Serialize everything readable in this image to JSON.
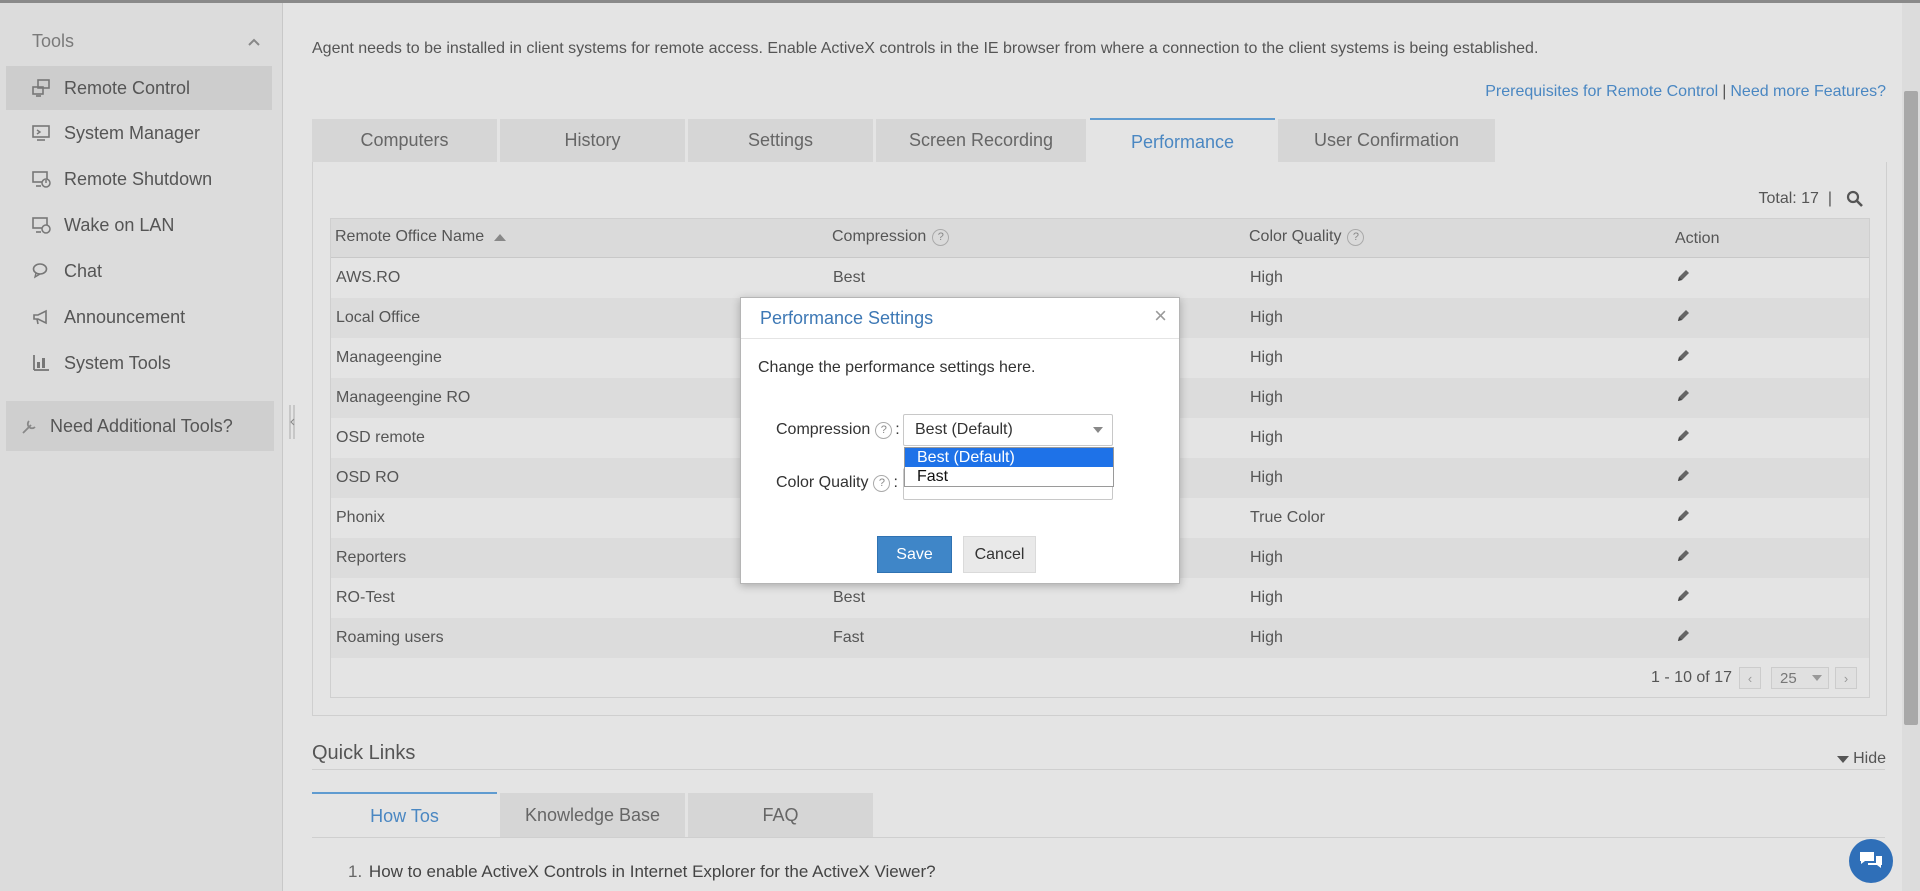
{
  "sidebar": {
    "header": "Tools",
    "items": [
      {
        "label": "Remote Control",
        "icon": "remote-control-icon",
        "active": true
      },
      {
        "label": "System Manager",
        "icon": "system-manager-icon"
      },
      {
        "label": "Remote Shutdown",
        "icon": "remote-shutdown-icon"
      },
      {
        "label": "Wake on LAN",
        "icon": "wake-on-lan-icon"
      },
      {
        "label": "Chat",
        "icon": "chat-icon"
      },
      {
        "label": "Announcement",
        "icon": "megaphone-icon"
      },
      {
        "label": "System Tools",
        "icon": "system-tools-icon"
      }
    ],
    "additional": "Need Additional Tools?"
  },
  "notice": "Agent needs to be installed in client systems for remote access. Enable ActiveX controls in the IE browser from where a connection to the client systems is being established.",
  "links": {
    "prereq": "Prerequisites for Remote Control",
    "separator": "|",
    "more": "Need more Features?"
  },
  "tabs": [
    "Computers",
    "History",
    "Settings",
    "Screen Recording",
    "Performance",
    "User Confirmation"
  ],
  "active_tab": "Performance",
  "table": {
    "total": "Total: 17",
    "total_sep": "|",
    "headers": {
      "name": "Remote Office Name",
      "compression": "Compression",
      "color": "Color Quality",
      "action": "Action"
    },
    "rows": [
      {
        "name": "AWS.RO",
        "compression": "Best",
        "color": "High"
      },
      {
        "name": "Local Office",
        "compression": "",
        "color": "High"
      },
      {
        "name": "Manageengine",
        "compression": "",
        "color": "High"
      },
      {
        "name": "Manageengine RO",
        "compression": "",
        "color": "High"
      },
      {
        "name": "OSD remote",
        "compression": "",
        "color": "High"
      },
      {
        "name": "OSD RO",
        "compression": "",
        "color": "High"
      },
      {
        "name": "Phonix",
        "compression": "",
        "color": "True Color"
      },
      {
        "name": "Reporters",
        "compression": "",
        "color": "High"
      },
      {
        "name": "RO-Test",
        "compression": "Best",
        "color": "High"
      },
      {
        "name": "Roaming users",
        "compression": "Fast",
        "color": "High"
      }
    ],
    "pager": {
      "range": "1 - 10 of 17",
      "page_size": "25",
      "prev": "‹",
      "next": "›"
    }
  },
  "quick_links": {
    "title": "Quick Links",
    "hide": "Hide",
    "tabs": [
      "How Tos",
      "Knowledge Base",
      "FAQ"
    ],
    "active_tab": "How Tos",
    "items": [
      {
        "num": "1.",
        "text": "How to enable ActiveX Controls in Internet Explorer for the ActiveX Viewer?"
      }
    ]
  },
  "modal": {
    "title": "Performance Settings",
    "close": "×",
    "description": "Change the performance settings here.",
    "compression_label": "Compression",
    "color_label": "Color Quality",
    "help": "?",
    "colon": ":",
    "compression_value": "Best (Default)",
    "dropdown_options": [
      "Best (Default)",
      "Fast"
    ],
    "selected_option": "Best (Default)",
    "save": "Save",
    "cancel": "Cancel"
  },
  "colors": {
    "accent": "#3f86c8",
    "link": "#4a87c2",
    "dropdown_highlight": "#1e72e8",
    "chat": "#2f6fb8"
  }
}
